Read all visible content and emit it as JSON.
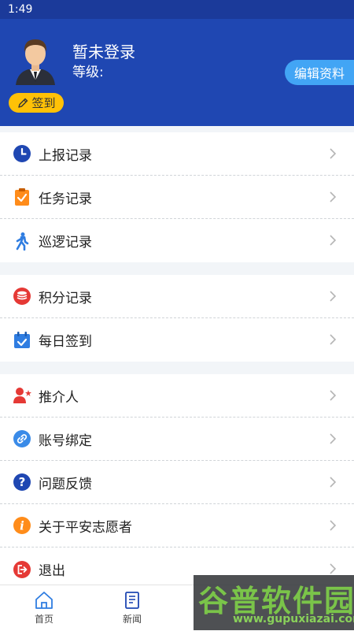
{
  "status_bar": {
    "time": "1:49"
  },
  "header": {
    "user_name": "暂未登录",
    "level_label": "等级:",
    "level_value": "",
    "checkin_label": "签到",
    "edit_profile_label": "编辑资料"
  },
  "menu": {
    "group1": [
      {
        "label": "上报记录",
        "icon": "clock-icon",
        "color": "#1f47b2"
      },
      {
        "label": "任务记录",
        "icon": "clipboard-check-icon",
        "color": "#ff8c1a"
      },
      {
        "label": "巡逻记录",
        "icon": "walking-person-icon",
        "color": "#2f7de1"
      }
    ],
    "group2": [
      {
        "label": "积分记录",
        "icon": "coin-stack-icon",
        "color": "#e53935"
      },
      {
        "label": "每日签到",
        "icon": "calendar-check-icon",
        "color": "#2f7de1"
      }
    ],
    "group3": [
      {
        "label": "推介人",
        "icon": "user-star-icon",
        "color": "#e53935"
      },
      {
        "label": "账号绑定",
        "icon": "link-icon",
        "color": "#3a8be8"
      },
      {
        "label": "问题反馈",
        "icon": "question-icon",
        "color": "#1f47b2"
      },
      {
        "label": "关于平安志愿者",
        "icon": "info-icon",
        "color": "#ff8c1a"
      },
      {
        "label": "退出",
        "icon": "logout-icon",
        "color": "#e53935"
      }
    ]
  },
  "tabbar": {
    "home_label": "首页",
    "news_label": "新闻"
  },
  "watermark": {
    "title": "谷普软件园",
    "url": "www.gupuxiazai.com"
  }
}
